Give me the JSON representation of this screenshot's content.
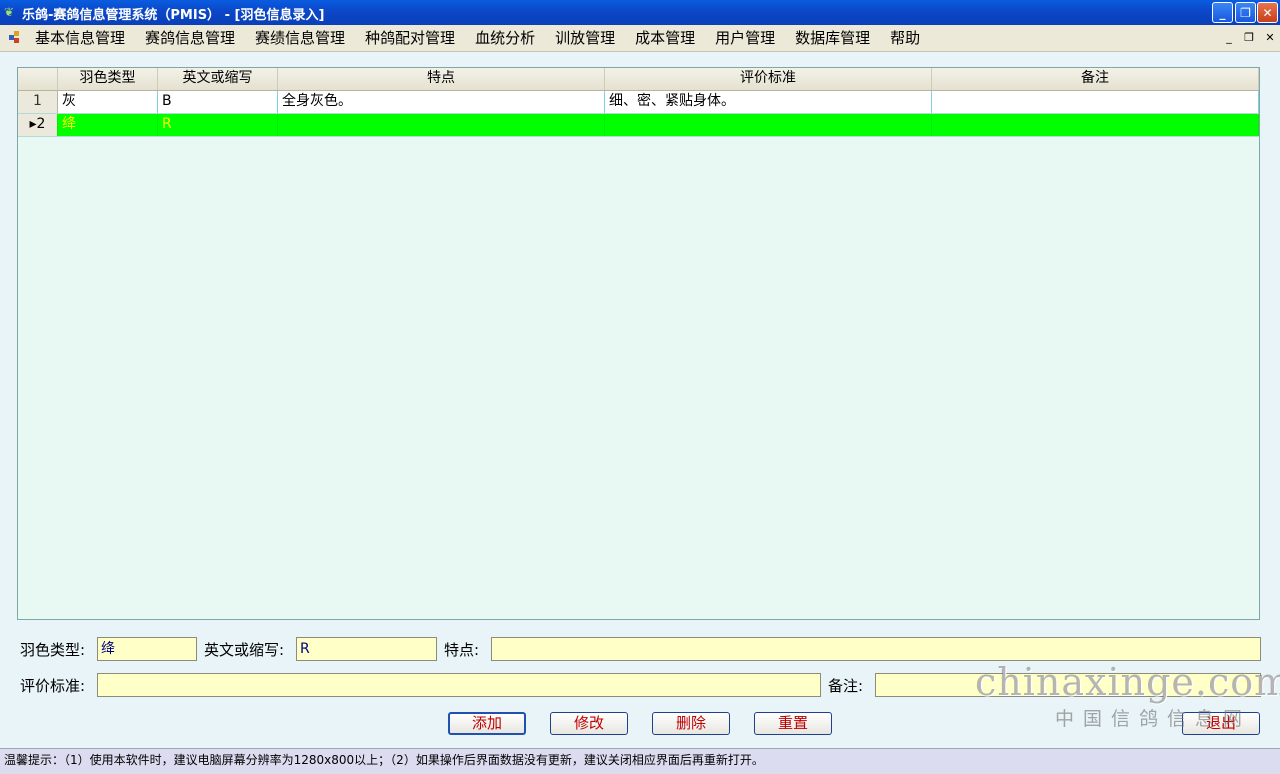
{
  "window": {
    "title": "乐鸽-赛鸽信息管理系统（PMIS） - [羽色信息录入]",
    "minimize": "_",
    "restore": "❐",
    "close": "✕"
  },
  "menu": {
    "items": [
      "基本信息管理",
      "赛鸽信息管理",
      "赛绩信息管理",
      "种鸽配对管理",
      "血统分析",
      "训放管理",
      "成本管理",
      "用户管理",
      "数据库管理",
      "帮助"
    ],
    "mdi_minimize": "_",
    "mdi_restore": "❐",
    "mdi_close": "✕"
  },
  "grid": {
    "columns": [
      "",
      "羽色类型",
      "英文或缩写",
      "特点",
      "评价标准",
      "备注"
    ],
    "rows": [
      {
        "num": "1",
        "type": "灰",
        "abbr": "B",
        "feature": "全身灰色。",
        "standard": "细、密、紧贴身体。",
        "note": ""
      },
      {
        "num": "▸2",
        "type": "绛",
        "abbr": "R",
        "feature": "",
        "standard": "",
        "note": ""
      }
    ]
  },
  "form": {
    "type_label": "羽色类型:",
    "type_value": "绛",
    "abbr_label": "英文或缩写:",
    "abbr_value": "R",
    "feature_label": "特点:",
    "feature_value": "",
    "standard_label": "评价标准:",
    "standard_value": "",
    "note_label": "备注:",
    "note_value": ""
  },
  "buttons": {
    "add": "添加",
    "edit": "修改",
    "delete": "删除",
    "reset": "重置",
    "exit": "退出"
  },
  "watermark": {
    "line1": "chinaxinge.com",
    "line2": "中国信鸽信息网"
  },
  "status": "温馨提示：（1）使用本软件时，建议电脑屏幕分辨率为1280x800以上；（2）如果操作后界面数据没有更新，建议关闭相应界面后再重新打开。"
}
